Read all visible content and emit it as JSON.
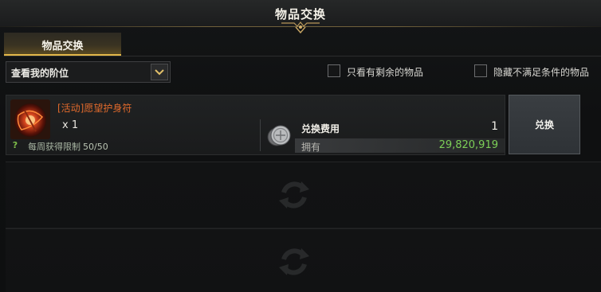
{
  "window": {
    "title": "物品交换"
  },
  "tabs": [
    {
      "label": "物品交换",
      "active": true
    }
  ],
  "filters": {
    "tier_dropdown": {
      "selected": "查看我的阶位"
    },
    "checkbox_remaining": {
      "label": "只看有剩余的物品",
      "checked": false
    },
    "checkbox_hide_unmet": {
      "label": "隐藏不满足条件的物品",
      "checked": false
    }
  },
  "items": [
    {
      "name": "[活动]愿望护身符",
      "quantity": "x 1",
      "limit_label": "每周获得限制",
      "limit_value": "50/50",
      "cost_label": "兑换费用",
      "cost_value": "1",
      "owned_label": "拥有",
      "owned_value": "29,820,919",
      "exchange_label": "兑换"
    }
  ],
  "empty_slots": [
    {
      "icon": "exchange-arrows-icon"
    },
    {
      "icon": "exchange-arrows-icon"
    }
  ],
  "colors": {
    "accent_gold": "#e4b84a",
    "item_name": "#e06a2c",
    "owned_green": "#7ccf57",
    "help_green": "#7fbf4a"
  }
}
